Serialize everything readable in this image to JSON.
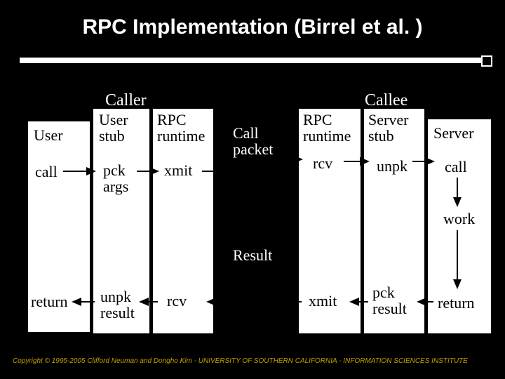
{
  "title": "RPC Implementation (Birrel et al. )",
  "captions": {
    "caller": "Caller",
    "callee": "Callee"
  },
  "cols": {
    "user": {
      "header": "User",
      "step_call": "call",
      "step_return": "return"
    },
    "user_stub": {
      "header": "User\nstub",
      "step_call": "pck\nargs",
      "step_return": "unpk\nresult"
    },
    "rpc_rt_c": {
      "header": "RPC\nruntime",
      "step_call": "xmit",
      "step_return": "rcv"
    },
    "rpc_rt_s": {
      "header": "RPC\nruntime",
      "step_call": "rcv",
      "step_return": "xmit"
    },
    "srv_stub": {
      "header": "Server\nstub",
      "step_call": "unpk",
      "step_return": "pck\nresult"
    },
    "server": {
      "header": "Server",
      "step_call": "call",
      "step_work": "work",
      "step_return": "return"
    }
  },
  "mid": {
    "call_packet": "Call\npacket",
    "result": "Result"
  },
  "footer": "Copyright © 1995-2005 Clifford Neuman and Dongho Kim - UNIVERSITY OF SOUTHERN CALIFORNIA - INFORMATION SCIENCES INSTITUTE"
}
